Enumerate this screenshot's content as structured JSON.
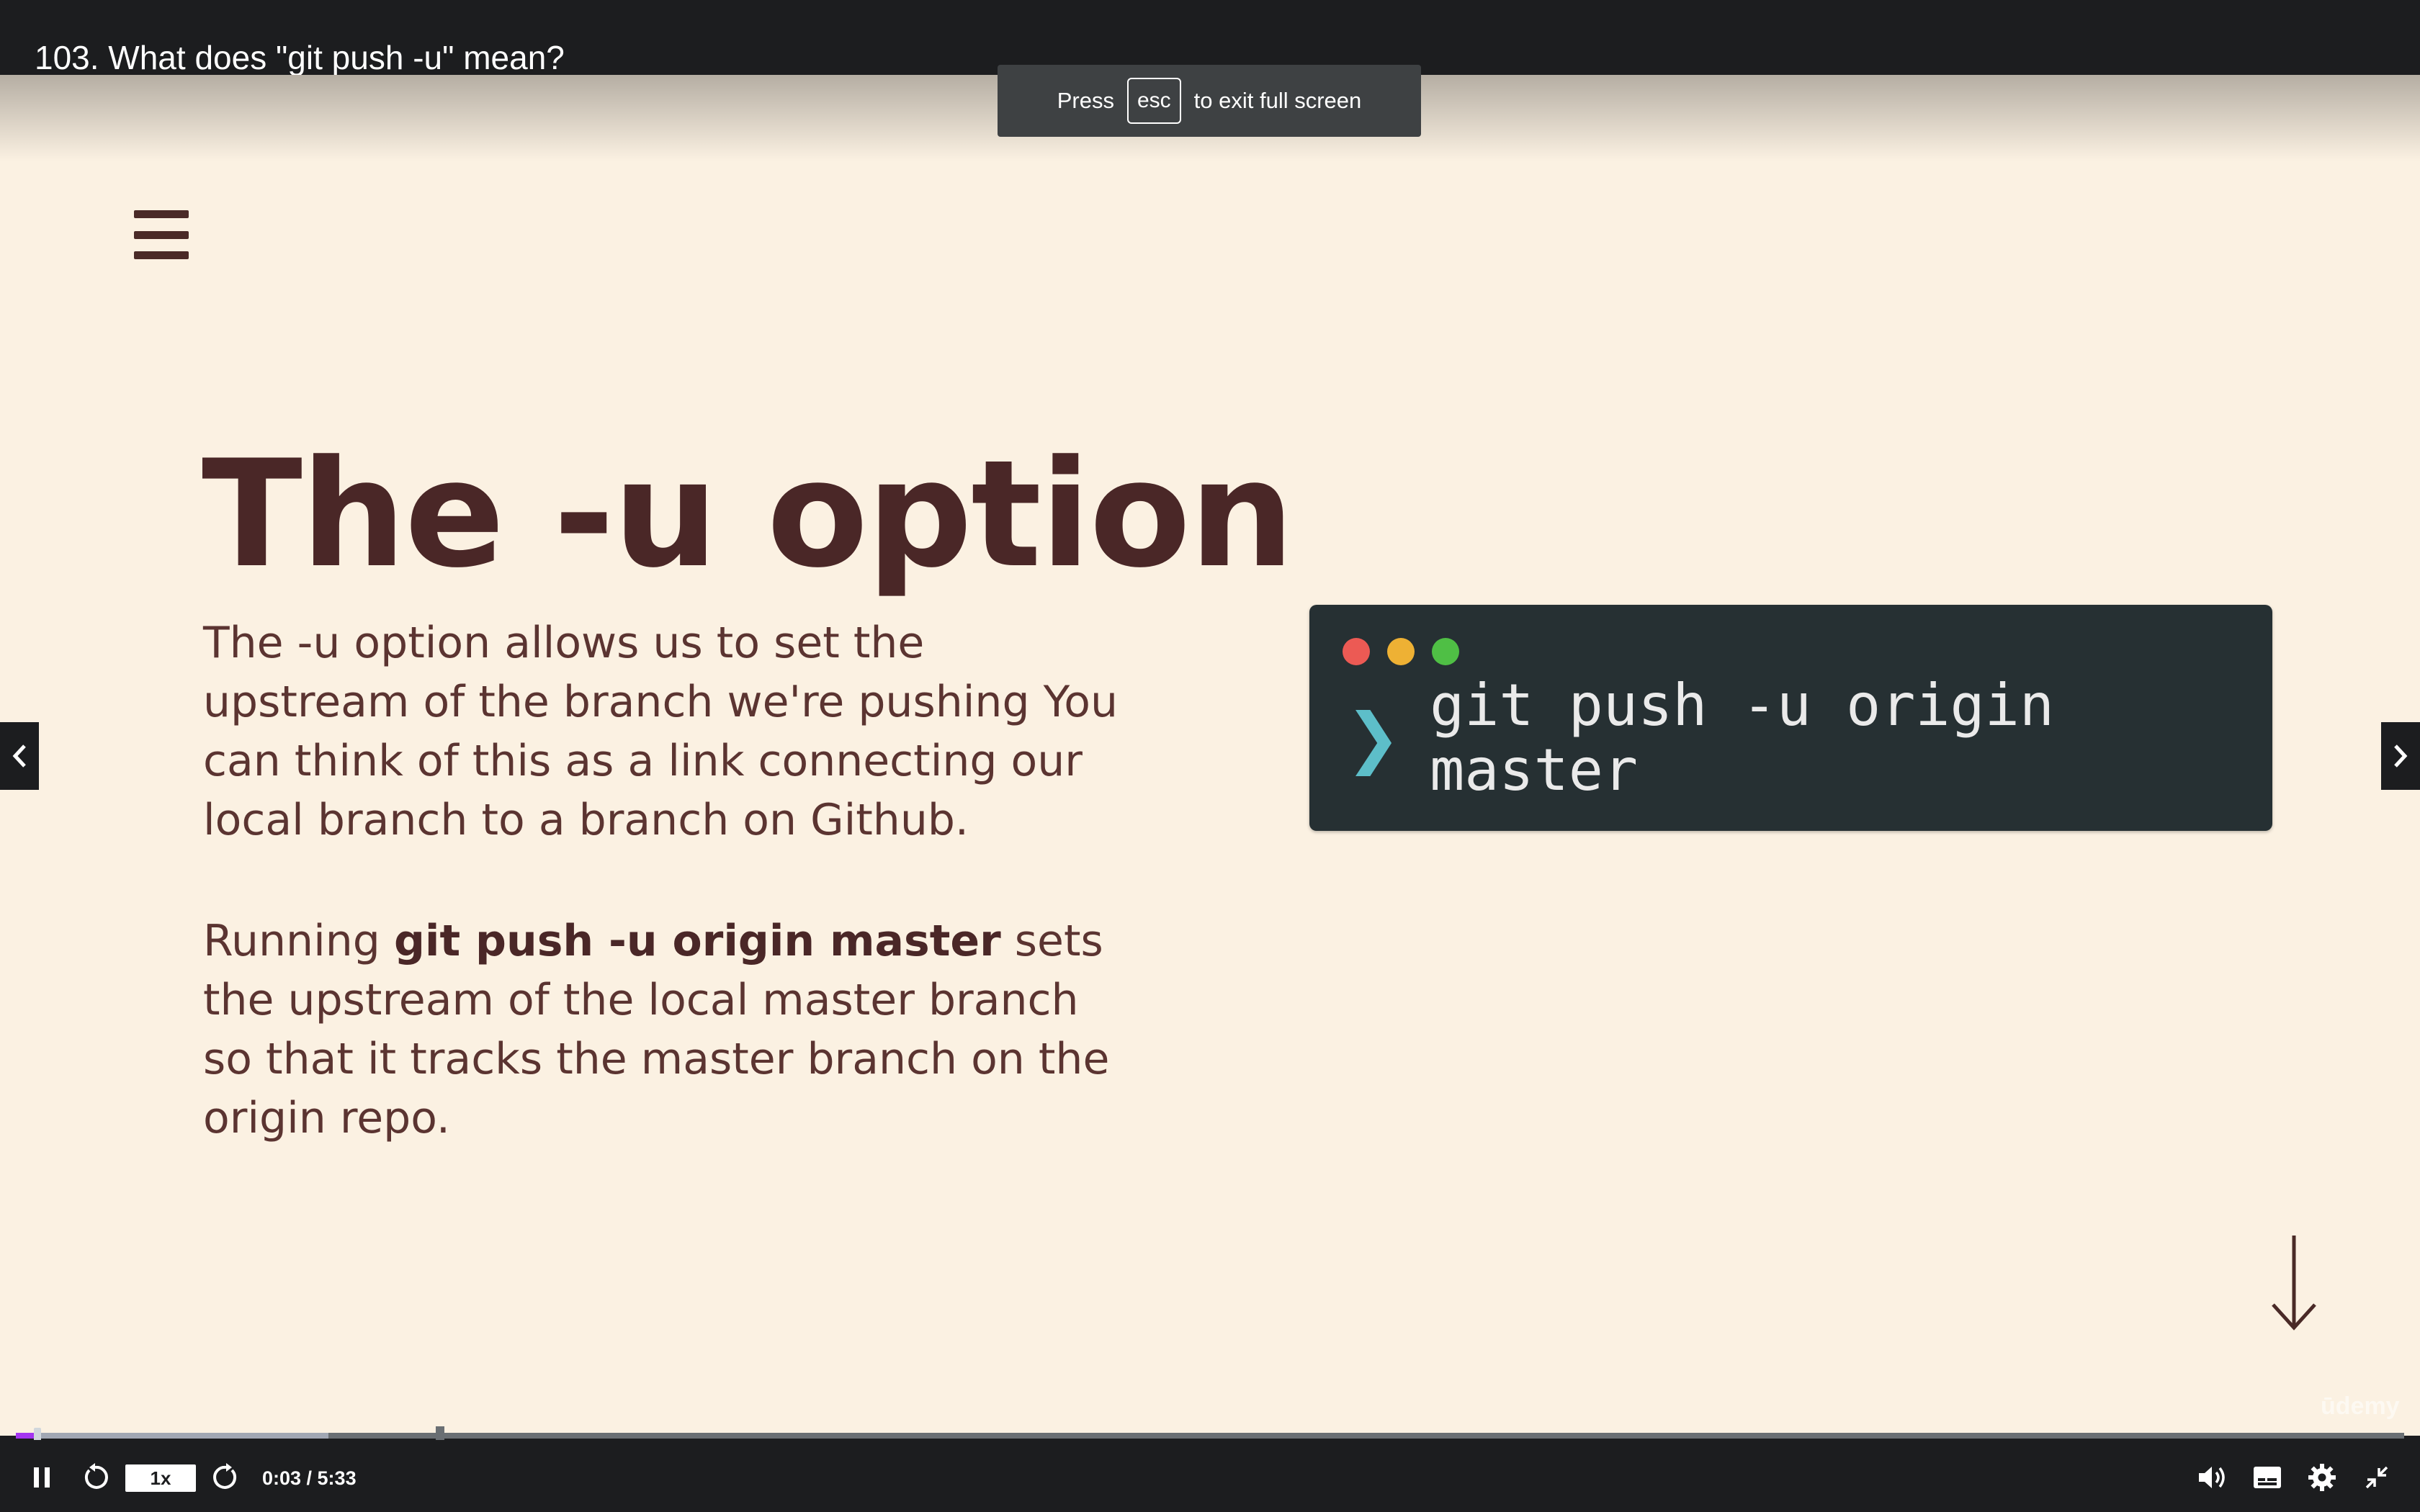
{
  "lecture": {
    "title": "103. What does \"git push -u\" mean?"
  },
  "fullscreen_toast": {
    "prefix": "Press",
    "key": "esc",
    "suffix": "to exit full screen"
  },
  "slide": {
    "heading": "The -u option",
    "paragraph1": "The -u option allows us to set the upstream of the branch we're pushing  You can think of this as a link connecting our local branch to a branch on Github.",
    "paragraph2_prefix": "Running ",
    "paragraph2_bold": "git push -u origin master",
    "paragraph2_suffix": " sets the upstream of the local master branch so that it tracks the master branch on the origin repo.",
    "terminal": {
      "prompt": "❯",
      "command": "git push -u origin master"
    },
    "watermark": "ūdemy"
  },
  "player": {
    "progress_fraction": 0.009,
    "buffered_fraction": 0.131,
    "speed": "1x",
    "time": "0:03 / 5:33"
  },
  "icons": {
    "menu": "hamburger-menu-icon",
    "prev": "chevron-left-icon",
    "next": "chevron-right-icon",
    "down": "arrow-down-icon",
    "pause": "pause-icon",
    "rewind": "rewind-5-icon",
    "forward": "forward-5-icon",
    "volume": "volume-icon",
    "captions": "captions-icon",
    "settings": "gear-icon",
    "exit_fullscreen": "exit-fullscreen-icon"
  },
  "colors": {
    "slide_background": "#fbf1e2",
    "heading": "#4a2727",
    "body_text": "#5b3431",
    "terminal_bg": "#263033",
    "prompt": "#5dbec9",
    "progress_accent": "#a435f0",
    "player_bg": "#1c1d1f"
  }
}
